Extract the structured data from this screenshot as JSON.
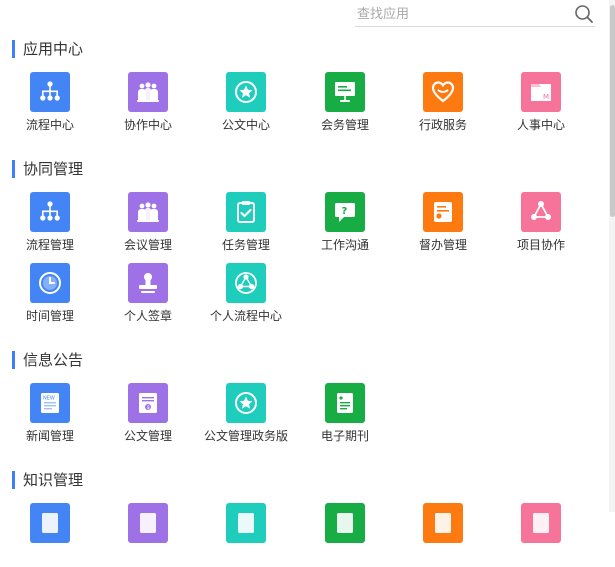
{
  "search": {
    "placeholder": "查找应用"
  },
  "colors": {
    "accent": "#3d7fff",
    "blue": "#4485f6",
    "purple": "#9f71e7",
    "teal": "#1fcdbd",
    "green": "#18ac45",
    "orange": "#fd7a10",
    "pink": "#f6739a"
  },
  "sections": [
    {
      "title": "应用中心",
      "apps": [
        {
          "label": "流程中心",
          "icon": "org-chart-icon",
          "color": "blue"
        },
        {
          "label": "协作中心",
          "icon": "group-icon",
          "color": "purple"
        },
        {
          "label": "公文中心",
          "icon": "star-badge-icon",
          "color": "teal"
        },
        {
          "label": "会务管理",
          "icon": "presentation-board-icon",
          "color": "green"
        },
        {
          "label": "行政服务",
          "icon": "heart-icon",
          "color": "orange"
        },
        {
          "label": "人事中心",
          "icon": "personnel-folder-icon",
          "color": "pink"
        }
      ]
    },
    {
      "title": "协同管理",
      "apps": [
        {
          "label": "流程管理",
          "icon": "org-chart-icon",
          "color": "blue"
        },
        {
          "label": "会议管理",
          "icon": "group-icon",
          "color": "purple"
        },
        {
          "label": "任务管理",
          "icon": "clipboard-check-icon",
          "color": "teal"
        },
        {
          "label": "工作沟通",
          "icon": "chat-question-icon",
          "color": "green"
        },
        {
          "label": "督办管理",
          "icon": "supervision-document-icon",
          "color": "orange"
        },
        {
          "label": "项目协作",
          "icon": "triangle-nodes-icon",
          "color": "pink"
        },
        {
          "label": "时间管理",
          "icon": "clock-icon",
          "color": "blue"
        },
        {
          "label": "个人签章",
          "icon": "stamp-icon",
          "color": "purple"
        },
        {
          "label": "个人流程中心",
          "icon": "network-circle-icon",
          "color": "teal"
        }
      ]
    },
    {
      "title": "信息公告",
      "apps": [
        {
          "label": "新闻管理",
          "icon": "news-icon",
          "color": "blue"
        },
        {
          "label": "公文管理",
          "icon": "official-document-icon",
          "color": "purple"
        },
        {
          "label": "公文管理政务版",
          "icon": "star-badge-icon",
          "color": "teal"
        },
        {
          "label": "电子期刊",
          "icon": "journal-icon",
          "color": "green"
        }
      ]
    },
    {
      "title": "知识管理",
      "apps": [
        {
          "label": "",
          "icon": "knowledge-icon",
          "color": "blue"
        },
        {
          "label": "",
          "icon": "knowledge-icon",
          "color": "purple"
        },
        {
          "label": "",
          "icon": "knowledge-icon",
          "color": "teal"
        },
        {
          "label": "",
          "icon": "knowledge-icon",
          "color": "green"
        },
        {
          "label": "",
          "icon": "knowledge-icon",
          "color": "orange"
        },
        {
          "label": "",
          "icon": "knowledge-icon",
          "color": "pink"
        }
      ]
    }
  ]
}
